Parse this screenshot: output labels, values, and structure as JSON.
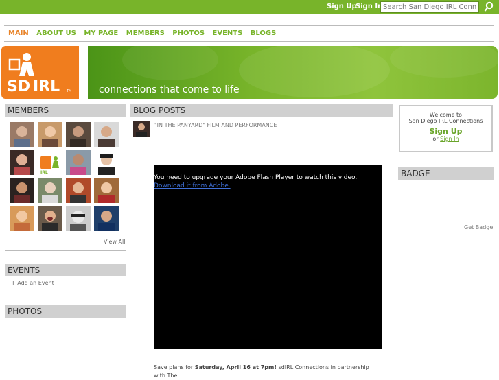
{
  "topbar": {
    "sign_up": "Sign Up",
    "sign_in": "Sign In",
    "search_placeholder": "Search San Diego IRL Connections"
  },
  "nav": {
    "items": [
      "MAIN",
      "ABOUT US",
      "MY PAGE",
      "MEMBERS",
      "PHOTOS",
      "EVENTS",
      "BLOGS"
    ]
  },
  "banner": {
    "logo_text": "SD IRL",
    "tagline": "connections that come to life"
  },
  "members": {
    "title": "MEMBERS",
    "view_all": "View All"
  },
  "events": {
    "title": "EVENTS",
    "add_event": "Add an Event"
  },
  "photos": {
    "title": "PHOTOS"
  },
  "blog": {
    "title": "BLOG POSTS",
    "post_title": "\"IN THE PANYARD\" FILM AND PERFORMANCE",
    "video_message": "You need to upgrade your Adobe Flash Player to watch this video.",
    "video_link": "Download it from Adobe.",
    "body_prefix": "Save plans for ",
    "body_bold": "Saturday, April 16 at 7pm!",
    "body_suffix": " sdIRL Connections in partnership with The"
  },
  "welcome": {
    "line1": "Welcome to",
    "line2": "San Diego IRL Connections",
    "sign_up": "Sign Up",
    "or": "or",
    "sign_in": "Sign In"
  },
  "badge": {
    "title": "BADGE",
    "get_badge": "Get Badge"
  },
  "colors": {
    "green": "#78b42a",
    "orange": "#f07d1e",
    "active_nav": "#e8842a"
  }
}
